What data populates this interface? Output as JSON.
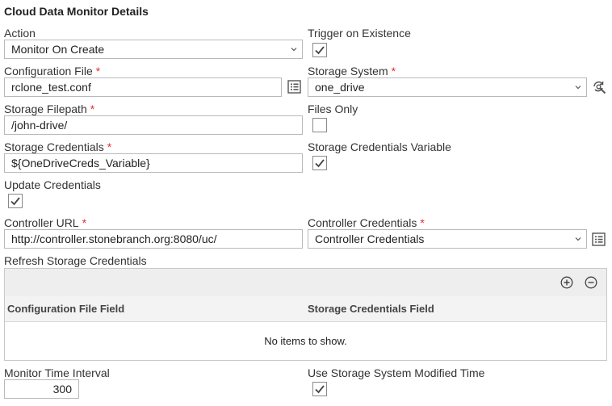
{
  "section_title": "Cloud Data Monitor Details",
  "action": {
    "label": "Action",
    "value": "Monitor On Create"
  },
  "trigger_on_existence": {
    "label": "Trigger on Existence",
    "checked": true
  },
  "configuration_file": {
    "label": "Configuration File",
    "required": "*",
    "value": "rclone_test.conf"
  },
  "storage_system": {
    "label": "Storage System",
    "required": "*",
    "value": "one_drive"
  },
  "storage_filepath": {
    "label": "Storage Filepath",
    "required": "*",
    "value": "/john-drive/"
  },
  "files_only": {
    "label": "Files Only",
    "checked": false
  },
  "storage_credentials": {
    "label": "Storage Credentials",
    "required": "*",
    "value": "${OneDriveCreds_Variable}"
  },
  "storage_credentials_variable": {
    "label": "Storage Credentials Variable",
    "checked": true
  },
  "update_credentials": {
    "label": "Update Credentials",
    "checked": true
  },
  "controller_url": {
    "label": "Controller URL",
    "required": "*",
    "value": "http://controller.stonebranch.org:8080/uc/"
  },
  "controller_credentials": {
    "label": "Controller Credentials",
    "required": "*",
    "value": "Controller Credentials"
  },
  "refresh_storage_credentials": {
    "label": "Refresh Storage Credentials",
    "columns": [
      "Configuration File Field",
      "Storage Credentials Field"
    ],
    "empty_text": "No items to show."
  },
  "monitor_time_interval": {
    "label": "Monitor Time Interval",
    "value": "300"
  },
  "use_storage_system_modified_time": {
    "label": "Use Storage System Modified Time",
    "checked": true
  },
  "colors": {
    "required": "#e03030",
    "border": "#b9b9b9",
    "toolbar_bg": "#eeeeee"
  }
}
